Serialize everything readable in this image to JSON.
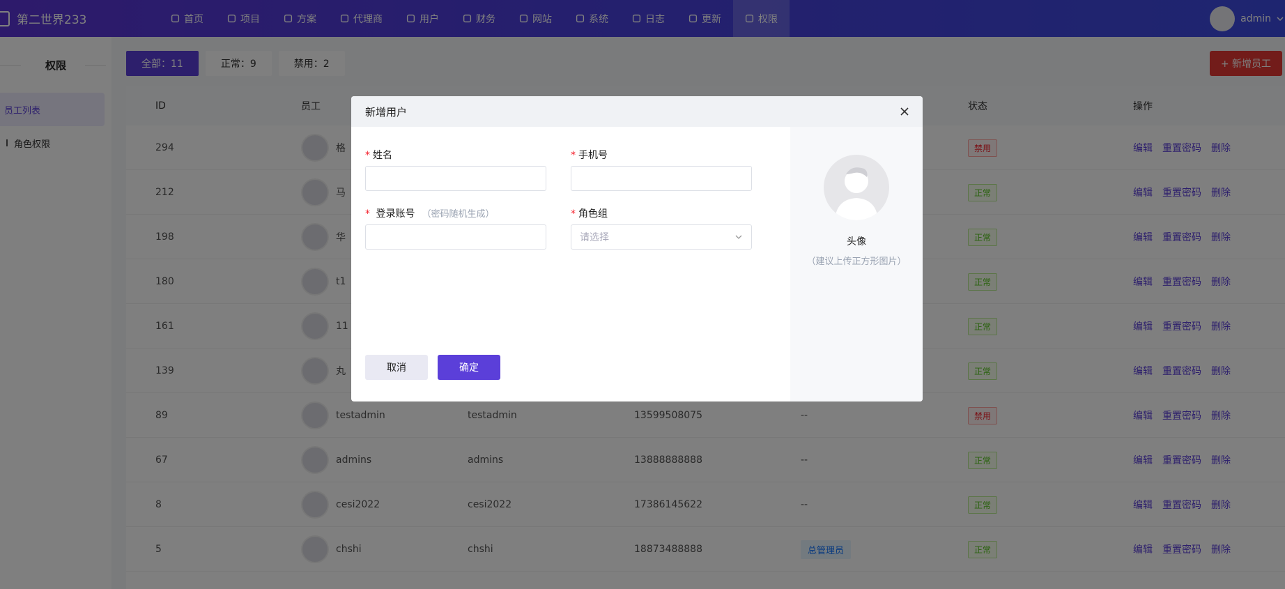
{
  "brand": {
    "name": "第二世界233"
  },
  "nav": [
    {
      "label": "首页",
      "icon": "home-icon"
    },
    {
      "label": "项目",
      "icon": "briefcase-icon"
    },
    {
      "label": "方案",
      "icon": "diamond-icon"
    },
    {
      "label": "代理商",
      "icon": "users-icon"
    },
    {
      "label": "用户",
      "icon": "user-icon"
    },
    {
      "label": "财务",
      "icon": "wallet-icon"
    },
    {
      "label": "网站",
      "icon": "layout-icon"
    },
    {
      "label": "系统",
      "icon": "gear-icon"
    },
    {
      "label": "日志",
      "icon": "document-icon"
    },
    {
      "label": "更新",
      "icon": "refresh-icon"
    },
    {
      "label": "权限",
      "icon": "shield-check-icon",
      "active": true
    }
  ],
  "user": {
    "name": "admin"
  },
  "sidebar": {
    "title": "权限",
    "items": [
      {
        "label": "员工列表",
        "active": true
      },
      {
        "label": "角色权限"
      }
    ]
  },
  "filters": [
    {
      "label": "全部：11",
      "active": true
    },
    {
      "label": "正常：9"
    },
    {
      "label": "禁用：2"
    }
  ],
  "add_button": "+ 新增员工",
  "table": {
    "headers": {
      "id": "ID",
      "staff": "员工",
      "status": "状态",
      "ops": "操作"
    },
    "ops": {
      "edit": "编辑",
      "reset": "重置密码",
      "delete": "删除"
    },
    "rows": [
      {
        "id": "294",
        "name": "格",
        "account": "",
        "phone": "",
        "role": "",
        "status": "禁用",
        "status_type": "ban"
      },
      {
        "id": "212",
        "name": "马",
        "account": "",
        "phone": "",
        "role": "",
        "status": "正常",
        "status_type": "ok"
      },
      {
        "id": "198",
        "name": "华",
        "account": "",
        "phone": "",
        "role": "",
        "status": "正常",
        "status_type": "ok"
      },
      {
        "id": "180",
        "name": "t1",
        "account": "",
        "phone": "",
        "role": "",
        "status": "正常",
        "status_type": "ok"
      },
      {
        "id": "161",
        "name": "11",
        "account": "",
        "phone": "",
        "role": "",
        "status": "正常",
        "status_type": "ok"
      },
      {
        "id": "139",
        "name": "丸",
        "account": "",
        "phone": "",
        "role": "",
        "status": "正常",
        "status_type": "ok"
      },
      {
        "id": "89",
        "name": "testadmin",
        "account": "testadmin",
        "phone": "13599508075",
        "role": "--",
        "status": "禁用",
        "status_type": "ban"
      },
      {
        "id": "67",
        "name": "admins",
        "account": "admins",
        "phone": "13888888888",
        "role": "--",
        "status": "正常",
        "status_type": "ok"
      },
      {
        "id": "8",
        "name": "cesi2022",
        "account": "cesi2022",
        "phone": "17386145622",
        "role": "--",
        "status": "正常",
        "status_type": "ok"
      },
      {
        "id": "5",
        "name": "chshi",
        "account": "chshi",
        "phone": "18873488888",
        "role": "总管理员",
        "status": "正常",
        "status_type": "ok"
      }
    ]
  },
  "modal": {
    "title": "新增用户",
    "fields": {
      "name_label": "姓名",
      "phone_label": "手机号",
      "account_label": "登录账号",
      "account_hint": "（密码随机生成）",
      "role_label": "角色组",
      "role_placeholder": "请选择"
    },
    "required_mark": "*",
    "cancel": "取消",
    "confirm": "确定",
    "avatar_label": "头像",
    "avatar_hint": "（建议上传正方形图片）"
  },
  "colors": {
    "primary": "#5b3fd9",
    "danger": "#e53935",
    "ok": "#52c41a"
  }
}
